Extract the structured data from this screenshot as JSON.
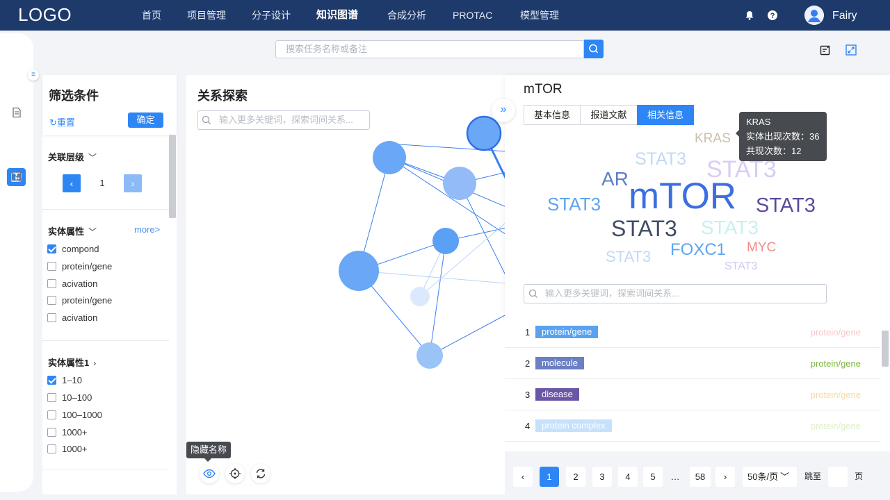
{
  "topbar": {
    "logo": "LOGO",
    "nav": [
      "首页",
      "项目管理",
      "分子设计",
      "知识图谱",
      "合成分析",
      "PROTAC",
      "模型管理"
    ],
    "active": "知识图谱",
    "username": "Fairy"
  },
  "search": {
    "placeholder": "搜索任务名称或备注"
  },
  "filter": {
    "title": "筛选条件",
    "reset": "重置",
    "confirm": "确定",
    "level": {
      "title": "关联层级",
      "value": "1"
    },
    "attr": {
      "title": "实体属性",
      "more": "more>",
      "options": [
        {
          "label": "compond",
          "checked": true
        },
        {
          "label": "protein/gene",
          "checked": false
        },
        {
          "label": "acivation",
          "checked": false
        },
        {
          "label": "protein/gene",
          "checked": false
        },
        {
          "label": "acivation",
          "checked": false
        }
      ]
    },
    "attr1": {
      "title": "实体属性1",
      "options": [
        {
          "label": "1–10",
          "checked": true
        },
        {
          "label": "10–100",
          "checked": false
        },
        {
          "label": "100–1000",
          "checked": false
        },
        {
          "label": "1000+",
          "checked": false
        },
        {
          "label": "1000+",
          "checked": false
        }
      ]
    }
  },
  "graph": {
    "title": "关系探索",
    "search_placeholder": "输入更多关键词，探索词间关系...",
    "tooltip": "隐藏名称"
  },
  "panel": {
    "title": "mTOR",
    "tabs": [
      "基本信息",
      "报道文献",
      "相关信息"
    ],
    "active_tab": "相关信息",
    "wordcloud": [
      {
        "text": "KRAS",
        "color": "#cbbfa8"
      },
      {
        "text": "STAT3",
        "color": "#c2d8f7"
      },
      {
        "text": "STAT3",
        "color": "#d9ccf5"
      },
      {
        "text": "AR",
        "color": "#5b7fc4"
      },
      {
        "text": "mTOR",
        "color": "#3b6fe0"
      },
      {
        "text": "STAT3",
        "color": "#5da4f2"
      },
      {
        "text": "STAT3",
        "color": "#5a4a9c"
      },
      {
        "text": "STAT3",
        "color": "#3f4c66"
      },
      {
        "text": "STAT3",
        "color": "#c7f0f0"
      },
      {
        "text": "STAT3",
        "color": "#c2d8f7"
      },
      {
        "text": "FOXC1",
        "color": "#5da4f2"
      },
      {
        "text": "MYC",
        "color": "#f08a8a"
      },
      {
        "text": "STAT3",
        "color": "#cfc8ef"
      }
    ],
    "tooltip": {
      "name": "KRAS",
      "line1": "实体出现次数：36",
      "line2": "共现次数：12"
    },
    "search_placeholder": "输入更多关键词，探索词间关系...",
    "rows": [
      {
        "num": "1",
        "tag": "protein/gene",
        "tag_color": "#5aa2f0",
        "type": "protein/gene",
        "type_color": "#f7c6c6"
      },
      {
        "num": "2",
        "tag": "molecule",
        "tag_color": "#6b7fc4",
        "type": "protein/gene",
        "type_color": "#7ab83a"
      },
      {
        "num": "3",
        "tag": "disease",
        "tag_color": "#6a56a6",
        "type": "protein/gene",
        "type_color": "#f7d9a6"
      },
      {
        "num": "4",
        "tag": "protein complex",
        "tag_color": "#c6e1fb",
        "type": "protein/gene",
        "type_color": "#d8f0c4"
      }
    ],
    "pager": {
      "pages": [
        "1",
        "2",
        "3",
        "4",
        "5"
      ],
      "ellipsis": "…",
      "last": "58",
      "size": "50条/页",
      "jump": "跳至",
      "unit": "页"
    }
  }
}
